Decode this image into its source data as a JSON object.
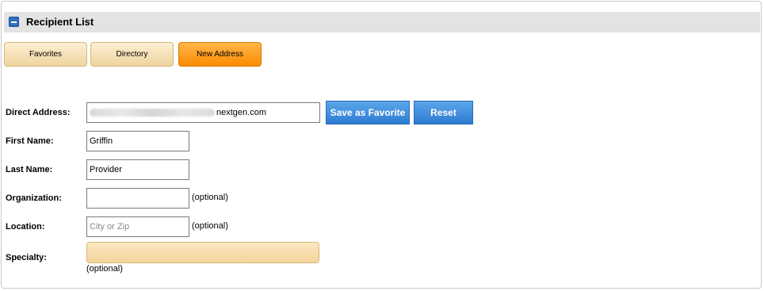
{
  "header": {
    "title": "Recipient List"
  },
  "tabs": [
    {
      "label": "Favorites"
    },
    {
      "label": "Directory"
    },
    {
      "label": "New Address"
    }
  ],
  "form": {
    "direct_address": {
      "label": "Direct Address:",
      "value_suffix": "nextgen.com"
    },
    "first_name": {
      "label": "First Name:",
      "value": "Griffin"
    },
    "last_name": {
      "label": "Last Name:",
      "value": "Provider"
    },
    "organization": {
      "label": "Organization:",
      "value": "",
      "note": "(optional)"
    },
    "location": {
      "label": "Location:",
      "placeholder": "City or Zip",
      "note": "(optional)"
    },
    "specialty": {
      "label": "Specialty:",
      "note": "(optional)"
    }
  },
  "buttons": {
    "save_favorite": "Save as Favorite",
    "reset": "Reset"
  },
  "colors": {
    "accent_blue": "#2f7bd1",
    "tab_active": "#fb8b00",
    "tab_inactive": "#efd49f"
  }
}
